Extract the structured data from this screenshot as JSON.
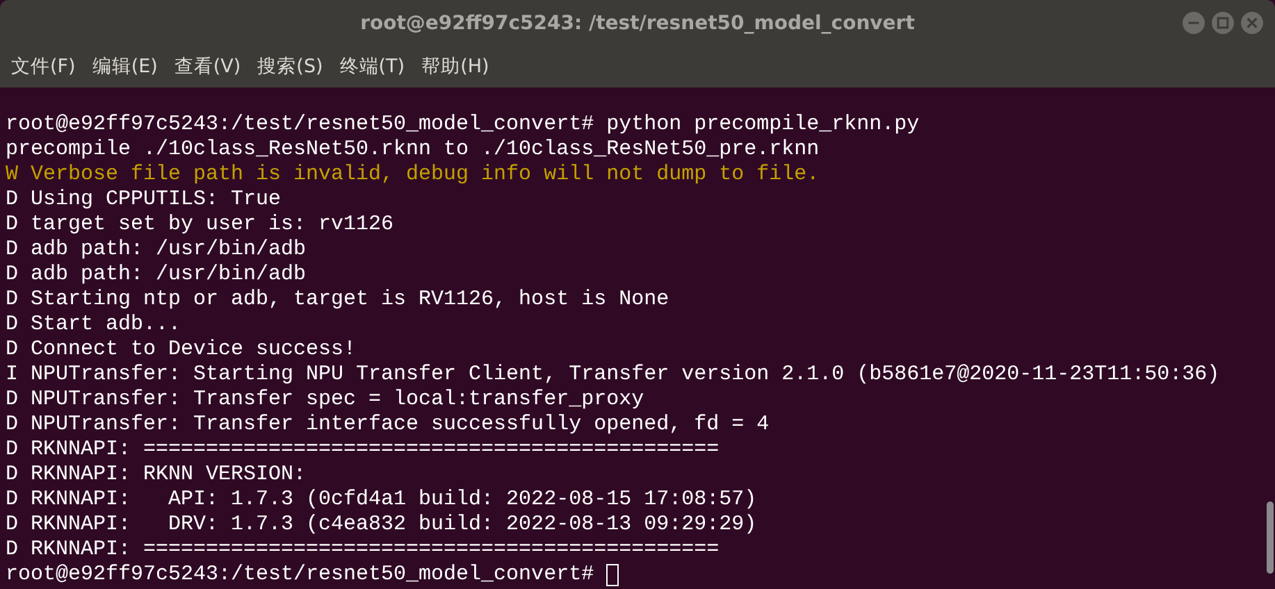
{
  "window": {
    "title": "root@e92ff97c5243: /test/resnet50_model_convert"
  },
  "menu": [
    "文件(F)",
    "编辑(E)",
    "查看(V)",
    "搜索(S)",
    "终端(T)",
    "帮助(H)"
  ],
  "terminal": {
    "lines": [
      {
        "kind": "output",
        "text": "root@e92ff97c5243:/test/resnet50_model_convert# python precompile_rknn.py"
      },
      {
        "kind": "output",
        "text": "precompile ./10class_ResNet50.rknn to ./10class_ResNet50_pre.rknn"
      },
      {
        "kind": "warning",
        "text": "W Verbose file path is invalid, debug info will not dump to file."
      },
      {
        "kind": "output",
        "text": "D Using CPPUTILS: True"
      },
      {
        "kind": "output",
        "text": "D target set by user is: rv1126"
      },
      {
        "kind": "output",
        "text": "D adb path: /usr/bin/adb"
      },
      {
        "kind": "output",
        "text": "D adb path: /usr/bin/adb"
      },
      {
        "kind": "output",
        "text": "D Starting ntp or adb, target is RV1126, host is None"
      },
      {
        "kind": "output",
        "text": "D Start adb..."
      },
      {
        "kind": "output",
        "text": "D Connect to Device success!"
      },
      {
        "kind": "output",
        "text": "I NPUTransfer: Starting NPU Transfer Client, Transfer version 2.1.0 (b5861e7@2020-11-23T11:50:36)"
      },
      {
        "kind": "output",
        "text": "D NPUTransfer: Transfer spec = local:transfer_proxy"
      },
      {
        "kind": "output",
        "text": "D NPUTransfer: Transfer interface successfully opened, fd = 4"
      },
      {
        "kind": "output",
        "text": "D RKNNAPI: =============================================="
      },
      {
        "kind": "output",
        "text": "D RKNNAPI: RKNN VERSION:"
      },
      {
        "kind": "output",
        "text": "D RKNNAPI:   API: 1.7.3 (0cfd4a1 build: 2022-08-15 17:08:57)"
      },
      {
        "kind": "output",
        "text": "D RKNNAPI:   DRV: 1.7.3 (c4ea832 build: 2022-08-13 09:29:29)"
      },
      {
        "kind": "output",
        "text": "D RKNNAPI: =============================================="
      },
      {
        "kind": "prompt",
        "text": "root@e92ff97c5243:/test/resnet50_model_convert#"
      }
    ]
  }
}
